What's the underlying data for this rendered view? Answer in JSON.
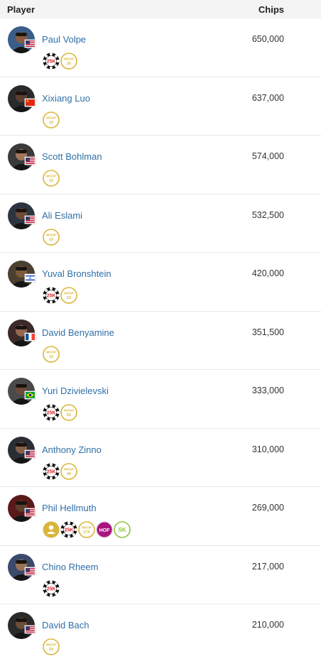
{
  "header": {
    "player": "Player",
    "chips": "Chips"
  },
  "badge_text": {
    "k25": "25K",
    "wsop": "WSOP",
    "hof": "HOF",
    "sk": "SK"
  },
  "colors": {
    "link": "#2f6fa8",
    "gold": "#d9b53a",
    "red": "#d8262e",
    "hof": "#a8157e",
    "green": "#8cc63f"
  },
  "players": [
    {
      "name": "Paul Volpe",
      "chips": "650,000",
      "flag": "us",
      "badges": [
        {
          "type": "k25"
        },
        {
          "type": "wsop",
          "count": "3X"
        }
      ]
    },
    {
      "name": "Xixiang Luo",
      "chips": "637,000",
      "flag": "cn",
      "badges": [
        {
          "type": "wsop",
          "count": "1X"
        }
      ]
    },
    {
      "name": "Scott Bohlman",
      "chips": "574,000",
      "flag": "us",
      "badges": [
        {
          "type": "wsop",
          "count": "1X"
        }
      ]
    },
    {
      "name": "Ali Eslami",
      "chips": "532,500",
      "flag": "us",
      "badges": [
        {
          "type": "wsop",
          "count": "1X"
        }
      ]
    },
    {
      "name": "Yuval Bronshtein",
      "chips": "420,000",
      "flag": "il",
      "badges": [
        {
          "type": "k25"
        },
        {
          "type": "wsop",
          "count": "2X"
        }
      ]
    },
    {
      "name": "David Benyamine",
      "chips": "351,500",
      "flag": "fr",
      "badges": [
        {
          "type": "wsop",
          "count": "1X"
        }
      ]
    },
    {
      "name": "Yuri Dzivielevski",
      "chips": "333,000",
      "flag": "br",
      "badges": [
        {
          "type": "k25"
        },
        {
          "type": "wsop",
          "count": "5X"
        }
      ]
    },
    {
      "name": "Anthony Zinno",
      "chips": "310,000",
      "flag": "us",
      "badges": [
        {
          "type": "k25"
        },
        {
          "type": "wsop",
          "count": "4X"
        }
      ]
    },
    {
      "name": "Phil Hellmuth",
      "chips": "269,000",
      "flag": "us",
      "badges": [
        {
          "type": "player-of-year"
        },
        {
          "type": "k25"
        },
        {
          "type": "wsop",
          "count": "17X"
        },
        {
          "type": "hof"
        },
        {
          "type": "sk"
        }
      ]
    },
    {
      "name": "Chino Rheem",
      "chips": "217,000",
      "flag": "us",
      "badges": [
        {
          "type": "k25"
        }
      ]
    },
    {
      "name": "David Bach",
      "chips": "210,000",
      "flag": "us",
      "badges": [
        {
          "type": "wsop",
          "count": "2X"
        }
      ]
    }
  ]
}
